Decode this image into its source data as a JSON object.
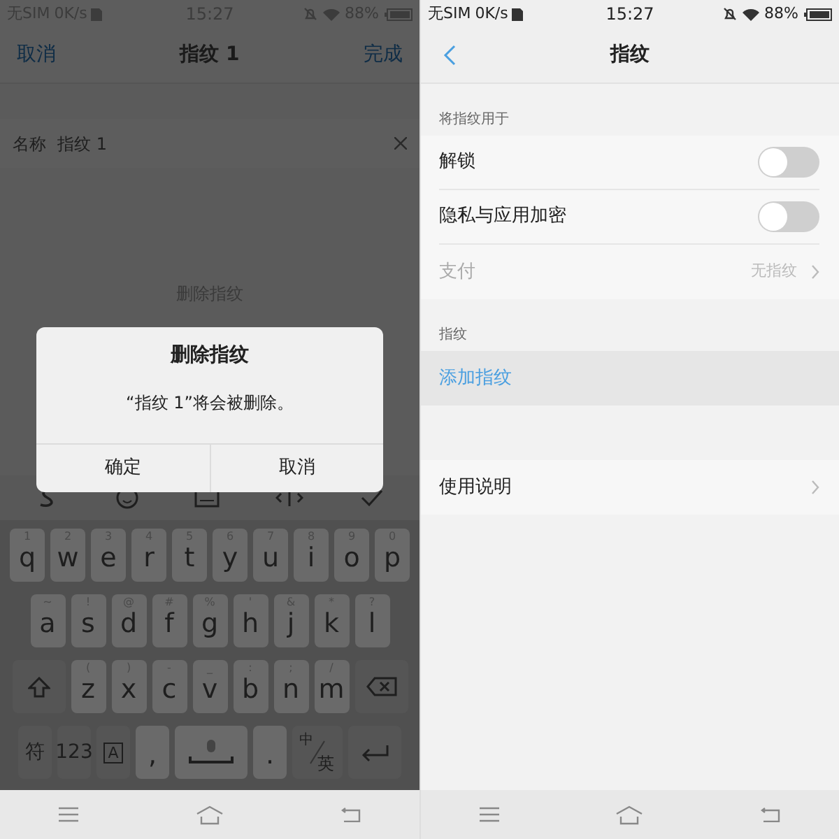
{
  "left_screen": {
    "status_bar": {
      "carrier": "无SIM",
      "speed": "0K/s",
      "time": "15:27",
      "battery": "88%"
    },
    "nav": {
      "cancel": "取消",
      "title": "指纹 1",
      "done": "完成"
    },
    "name_field": {
      "label": "名称",
      "value": "指纹 1"
    },
    "delete_button": "删除指纹",
    "dialog": {
      "title": "删除指纹",
      "message": "“指纹 1”将会被删除。",
      "buttons": [
        "确定",
        "取消"
      ]
    },
    "keyboard": {
      "rows": [
        [
          {
            "kind": "letter",
            "label": "q",
            "hint": "1"
          },
          {
            "kind": "letter",
            "label": "w",
            "hint": "2"
          },
          {
            "kind": "letter",
            "label": "e",
            "hint": "3"
          },
          {
            "kind": "letter",
            "label": "r",
            "hint": "4"
          },
          {
            "kind": "letter",
            "label": "t",
            "hint": "5"
          },
          {
            "kind": "letter",
            "label": "y",
            "hint": "6"
          },
          {
            "kind": "letter",
            "label": "u",
            "hint": "7"
          },
          {
            "kind": "letter",
            "label": "i",
            "hint": "8"
          },
          {
            "kind": "letter",
            "label": "o",
            "hint": "9"
          },
          {
            "kind": "letter",
            "label": "p",
            "hint": "0"
          }
        ],
        [
          {
            "kind": "letter",
            "label": "a",
            "hint": "~"
          },
          {
            "kind": "letter",
            "label": "s",
            "hint": "!"
          },
          {
            "kind": "letter",
            "label": "d",
            "hint": "@"
          },
          {
            "kind": "letter",
            "label": "f",
            "hint": "#"
          },
          {
            "kind": "letter",
            "label": "g",
            "hint": "%"
          },
          {
            "kind": "letter",
            "label": "h",
            "hint": "'"
          },
          {
            "kind": "letter",
            "label": "j",
            "hint": "&"
          },
          {
            "kind": "letter",
            "label": "k",
            "hint": "*"
          },
          {
            "kind": "letter",
            "label": "l",
            "hint": "?"
          }
        ],
        [
          {
            "kind": "shift"
          },
          {
            "kind": "letter",
            "label": "z",
            "hint": "("
          },
          {
            "kind": "letter",
            "label": "x",
            "hint": ")"
          },
          {
            "kind": "letter",
            "label": "c",
            "hint": "-"
          },
          {
            "kind": "letter",
            "label": "v",
            "hint": "_"
          },
          {
            "kind": "letter",
            "label": "b",
            "hint": ":"
          },
          {
            "kind": "letter",
            "label": "n",
            "hint": ";"
          },
          {
            "kind": "letter",
            "label": "m",
            "hint": "/"
          },
          {
            "kind": "backspace"
          }
        ],
        [
          {
            "kind": "function",
            "label": "符"
          },
          {
            "kind": "function",
            "label": "123"
          },
          {
            "kind": "boxed",
            "label": "A"
          },
          {
            "kind": "letter",
            "label": ","
          },
          {
            "kind": "space"
          },
          {
            "kind": "letter",
            "label": "."
          },
          {
            "kind": "language",
            "label": "英",
            "hint": "中"
          },
          {
            "kind": "enter"
          }
        ]
      ]
    }
  },
  "right_screen": {
    "status_bar": {
      "carrier": "无SIM",
      "speed": "0K/s",
      "time": "15:27",
      "battery": "88%"
    },
    "title": "指纹",
    "sections": [
      {
        "label": "将指纹用于",
        "items": [
          {
            "kind": "toggle",
            "label": "解锁",
            "on": false,
            "disabled": false
          },
          {
            "kind": "toggle",
            "label": "隐私与应用加密",
            "on": false,
            "disabled": false
          },
          {
            "kind": "link",
            "label": "支付",
            "value": "无指纹",
            "disabled": true
          }
        ]
      },
      {
        "label": "指纹",
        "items": [
          {
            "kind": "action",
            "label": "添加指纹",
            "highlighted": true
          }
        ]
      },
      {
        "items": [
          {
            "kind": "link",
            "label": "使用说明",
            "disabled": false
          }
        ]
      }
    ]
  }
}
